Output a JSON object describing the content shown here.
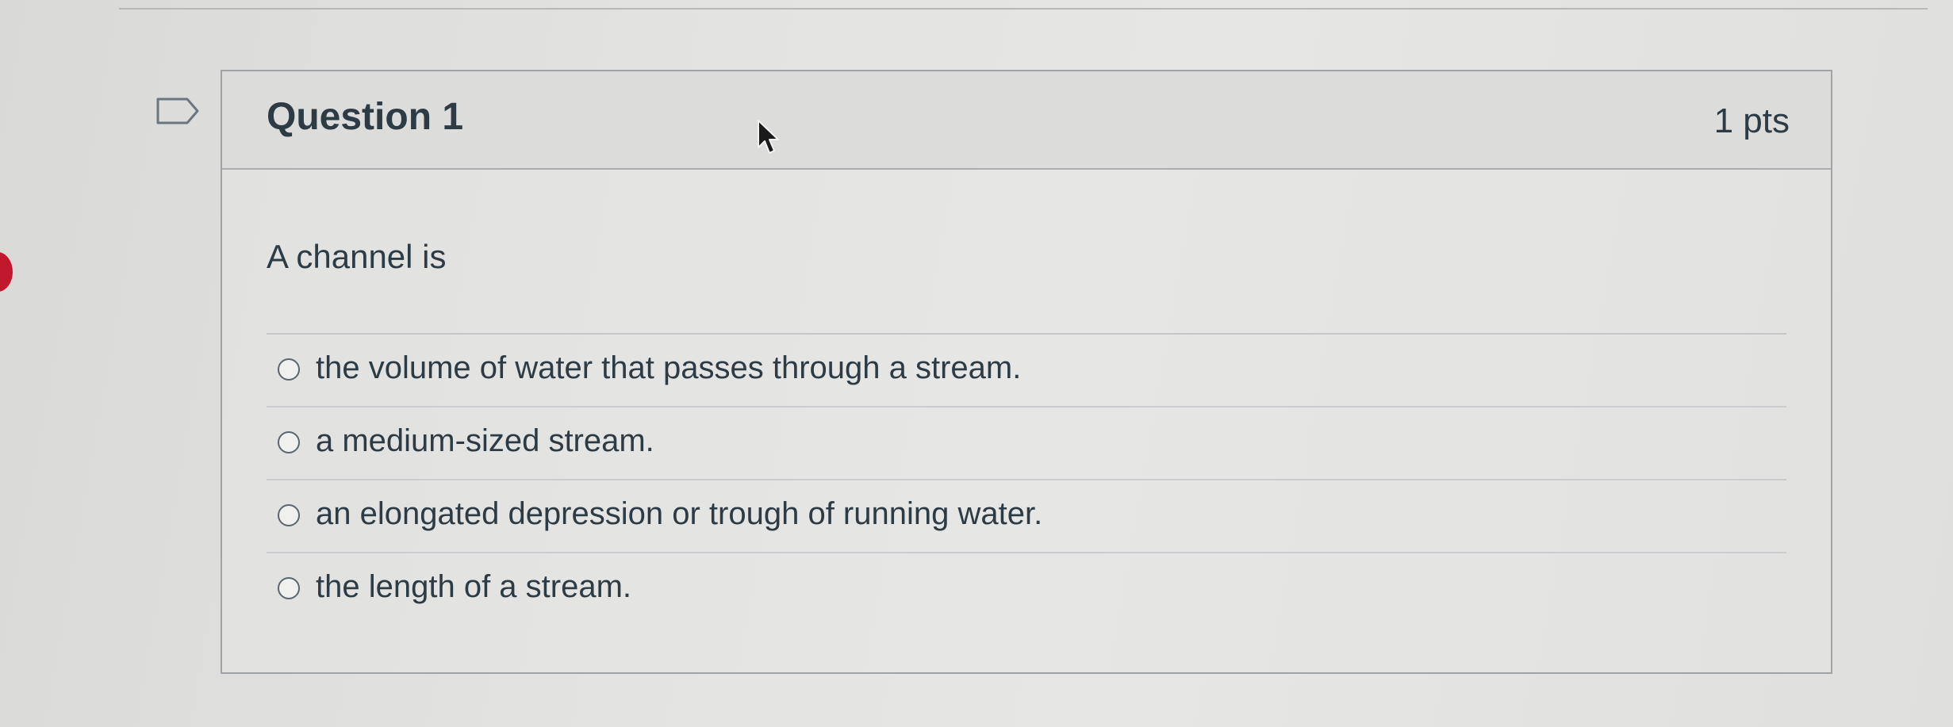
{
  "question": {
    "title": "Question 1",
    "points": "1 pts",
    "text": "A channel is",
    "answers": [
      {
        "label": "the volume of water that passes through a stream."
      },
      {
        "label": "a medium-sized stream."
      },
      {
        "label": "an elongated depression or trough of running water."
      },
      {
        "label": "the length of a stream."
      }
    ]
  },
  "icons": {
    "flag": "flag-outline-icon",
    "cursor": "mouse-pointer-icon"
  },
  "colors": {
    "text": "#2d3b45",
    "card_border": "#9fa3a5",
    "header_bg": "#dcdcda"
  }
}
